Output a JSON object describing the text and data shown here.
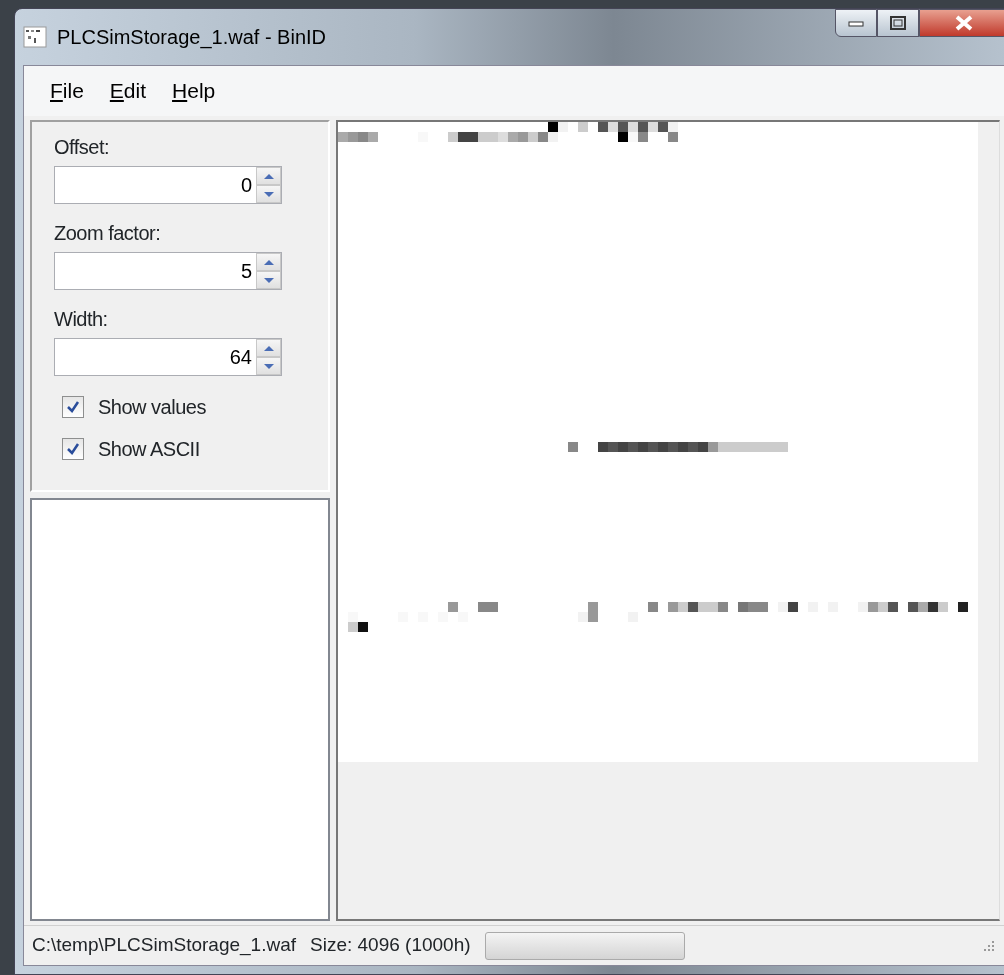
{
  "window": {
    "title": "PLCSimStorage_1.waf - BinID"
  },
  "menu": [
    {
      "label": "File"
    },
    {
      "label": "Edit"
    },
    {
      "label": "Help"
    }
  ],
  "settings": {
    "fields": [
      {
        "label": "Offset:",
        "value": "0"
      },
      {
        "label": "Zoom factor:",
        "value": "5"
      },
      {
        "label": "Width:",
        "value": "64"
      }
    ],
    "checkboxes": [
      {
        "label": "Show values",
        "checked": true
      },
      {
        "label": "Show ASCII",
        "checked": true
      }
    ]
  },
  "status_bar": {
    "path": "C:\\temp\\PLCSimStorage_1.waf",
    "size": "Size: 4096 (1000h)",
    "progress": {
      "level": 0
    }
  }
}
